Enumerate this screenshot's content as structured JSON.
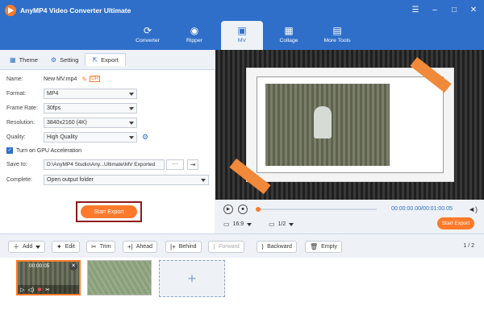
{
  "app": {
    "title": "AnyMP4 Video Converter Ultimate"
  },
  "window_controls": [
    "menu-icon",
    "minimize-icon",
    "maximize-icon",
    "close-icon"
  ],
  "nav": {
    "items": [
      {
        "label": "Converter",
        "icon": "converter-icon"
      },
      {
        "label": "Ripper",
        "icon": "ripper-icon"
      },
      {
        "label": "MV",
        "icon": "mv-icon",
        "active": true
      },
      {
        "label": "Collage",
        "icon": "collage-icon"
      },
      {
        "label": "More Tools",
        "icon": "toolbox-icon"
      }
    ]
  },
  "tabs": [
    {
      "label": "Theme",
      "icon": "theme-icon"
    },
    {
      "label": "Setting",
      "icon": "gear-icon"
    },
    {
      "label": "Export",
      "icon": "export-icon",
      "active": true
    }
  ],
  "form": {
    "name_label": "Name:",
    "name_value": "New MV.mp4",
    "format_label": "Format:",
    "format_value": "MP4",
    "framerate_label": "Frame Rate:",
    "framerate_value": "30fps",
    "resolution_label": "Resolution:",
    "resolution_value": "3840x2160 (4K)",
    "quality_label": "Quality:",
    "quality_value": "High Quality",
    "gpu_label": "Turn on GPU Acceleration",
    "gpu_checked": true,
    "saveto_label": "Save to:",
    "saveto_value": "D:\\AnyMP4 Studio\\Any...Ultimate\\MV Exported",
    "browse_label": "···",
    "complete_label": "Complete:",
    "complete_value": "Open output folder"
  },
  "export_button": "Start Export",
  "player": {
    "timecode": "00:00:00.00/00:01:00.05",
    "aspect_value": "16:9",
    "page_value": "1/2",
    "export_button": "Start Export"
  },
  "toolbar": {
    "add": "Add",
    "edit": "Edit",
    "trim": "Trim",
    "ahead": "Ahead",
    "behind": "Behind",
    "forward": "Forward",
    "backward": "Backward",
    "empty": "Empty",
    "pager": "1 / 2"
  },
  "timeline": {
    "clip1_time": "00:00:05",
    "add_symbol": "+"
  },
  "colors": {
    "brand_blue": "#2f6fc9",
    "accent_orange": "#ff7a2a",
    "highlight_border": "#8b1a1a"
  }
}
